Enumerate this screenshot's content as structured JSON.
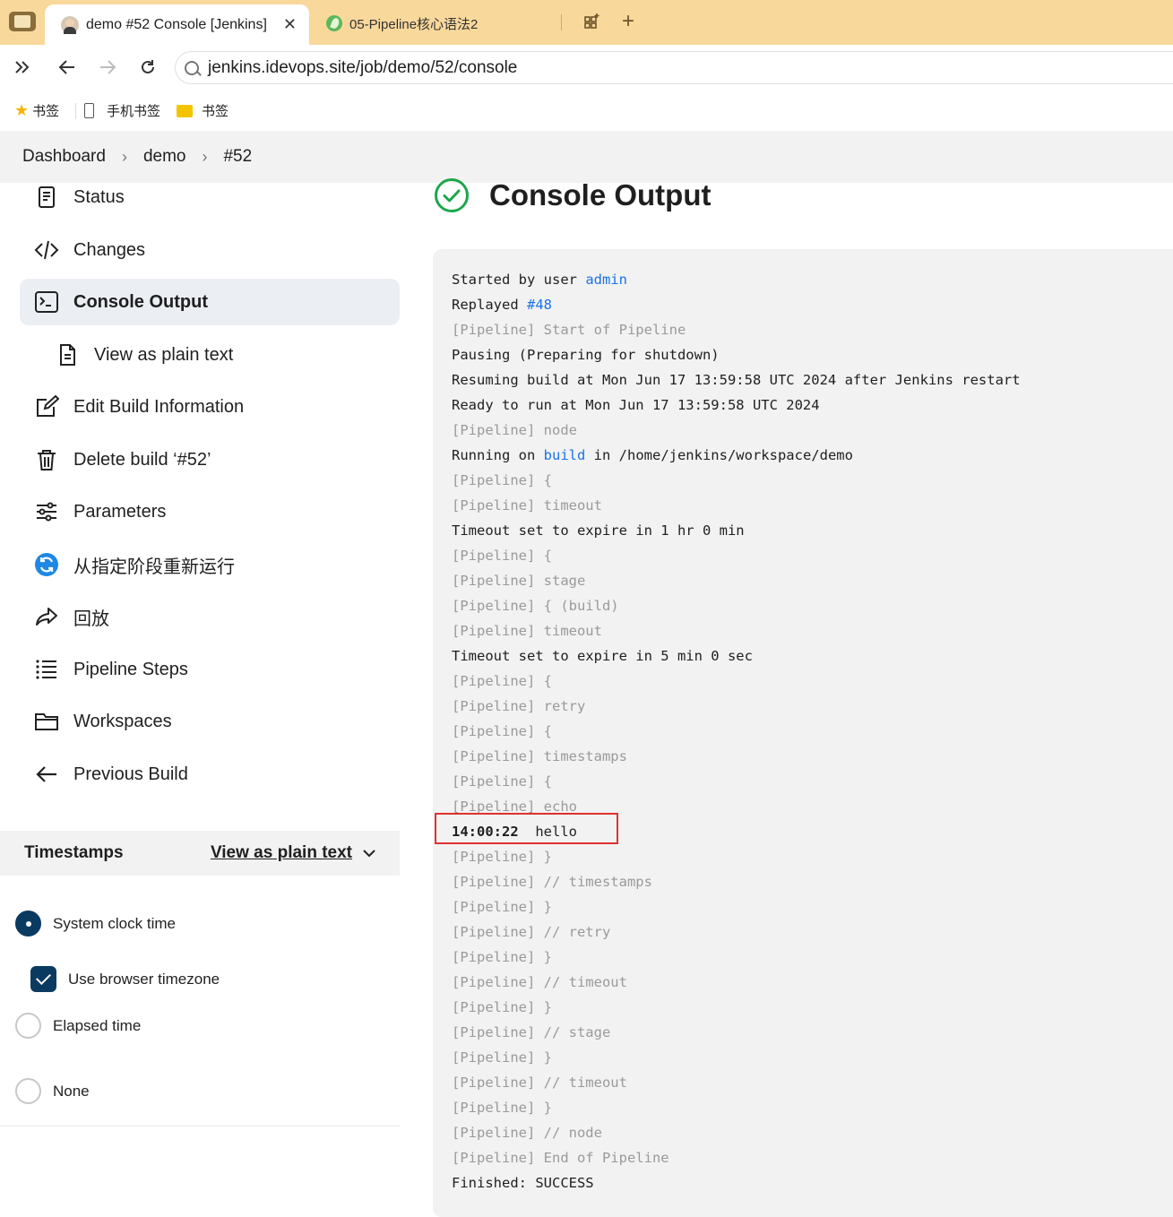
{
  "browser": {
    "active_tab": {
      "title": "demo #52 Console [Jenkins]",
      "close": "✕"
    },
    "inactive_tab": {
      "title": "05-Pipeline核心语法2"
    },
    "new_tab": "+",
    "url": "jenkins.idevops.site/job/demo/52/console",
    "bookmarks": [
      {
        "label": "书签",
        "icon": "star-icon"
      },
      {
        "label": "手机书签",
        "icon": "phone-icon"
      },
      {
        "label": "书签",
        "icon": "folder-icon"
      }
    ]
  },
  "breadcrumb": {
    "items": [
      "Dashboard",
      "demo",
      "#52"
    ],
    "separator": "›"
  },
  "sidebar": {
    "tasks": [
      {
        "label": "Status",
        "icon": "document-icon"
      },
      {
        "label": "Changes",
        "icon": "code-icon"
      },
      {
        "label": "Console Output",
        "icon": "terminal-icon",
        "active": true
      },
      {
        "label": "View as plain text",
        "icon": "file-icon"
      },
      {
        "label": "Edit Build Information",
        "icon": "edit-icon"
      },
      {
        "label": "Delete build ‘#52’",
        "icon": "trash-icon"
      },
      {
        "label": "Parameters",
        "icon": "sliders-icon"
      },
      {
        "label": "从指定阶段重新运行",
        "icon": "rerun-icon"
      },
      {
        "label": "回放",
        "icon": "replay-icon"
      },
      {
        "label": "Pipeline Steps",
        "icon": "list-icon"
      },
      {
        "label": "Workspaces",
        "icon": "folder-icon"
      },
      {
        "label": "Previous Build",
        "icon": "arrow-left-icon"
      }
    ],
    "timestamps": {
      "title": "Timestamps",
      "link": "View as plain text",
      "options": [
        {
          "label": "System clock time",
          "checked": true
        },
        {
          "label": "Use browser timezone",
          "checked": true,
          "type": "checkbox"
        },
        {
          "label": "Elapsed time",
          "checked": false
        },
        {
          "label": "None",
          "checked": false
        }
      ]
    }
  },
  "main": {
    "heading": "Console Output",
    "status": "success",
    "console": {
      "started_prefix": "Started by user ",
      "started_user": "admin",
      "replayed_prefix": "Replayed ",
      "replayed_build": "#48",
      "running_prefix": "Running on ",
      "running_node": "build",
      "running_suffix": " in /home/jenkins/workspace/demo",
      "echo_time": "14:00:22",
      "echo_text": "  hello",
      "lines": [
        {
          "text": "[Pipeline] Start of Pipeline",
          "pipe": true
        },
        {
          "text": "Pausing (Preparing for shutdown)"
        },
        {
          "text": "Resuming build at Mon Jun 17 13:59:58 UTC 2024 after Jenkins restart"
        },
        {
          "text": "Ready to run at Mon Jun 17 13:59:58 UTC 2024"
        },
        {
          "text": "[Pipeline] node",
          "pipe": true
        }
      ],
      "lines2": [
        {
          "text": "[Pipeline] {",
          "pipe": true
        },
        {
          "text": "[Pipeline] timeout",
          "pipe": true
        },
        {
          "text": "Timeout set to expire in 1 hr 0 min"
        },
        {
          "text": "[Pipeline] {",
          "pipe": true
        },
        {
          "text": "[Pipeline] stage",
          "pipe": true
        },
        {
          "text": "[Pipeline] { (build)",
          "pipe": true
        },
        {
          "text": "[Pipeline] timeout",
          "pipe": true
        },
        {
          "text": "Timeout set to expire in 5 min 0 sec"
        },
        {
          "text": "[Pipeline] {",
          "pipe": true
        },
        {
          "text": "[Pipeline] retry",
          "pipe": true
        },
        {
          "text": "[Pipeline] {",
          "pipe": true
        },
        {
          "text": "[Pipeline] timestamps",
          "pipe": true
        },
        {
          "text": "[Pipeline] {",
          "pipe": true
        },
        {
          "text": "[Pipeline] echo",
          "pipe": true
        }
      ],
      "lines3": [
        {
          "text": "[Pipeline] }",
          "pipe": true
        },
        {
          "text": "[Pipeline] // timestamps",
          "pipe": true
        },
        {
          "text": "[Pipeline] }",
          "pipe": true
        },
        {
          "text": "[Pipeline] // retry",
          "pipe": true
        },
        {
          "text": "[Pipeline] }",
          "pipe": true
        },
        {
          "text": "[Pipeline] // timeout",
          "pipe": true
        },
        {
          "text": "[Pipeline] }",
          "pipe": true
        },
        {
          "text": "[Pipeline] // stage",
          "pipe": true
        },
        {
          "text": "[Pipeline] }",
          "pipe": true
        },
        {
          "text": "[Pipeline] // timeout",
          "pipe": true
        },
        {
          "text": "[Pipeline] }",
          "pipe": true
        },
        {
          "text": "[Pipeline] // node",
          "pipe": true
        },
        {
          "text": "[Pipeline] End of Pipeline",
          "pipe": true
        },
        {
          "text": "Finished: SUCCESS"
        }
      ]
    }
  },
  "colors": {
    "tabstrip": "#f9d89c",
    "link": "#1a73e8",
    "success": "#1ea64b",
    "accent": "#0b3a61",
    "highlight": "#e03131"
  }
}
